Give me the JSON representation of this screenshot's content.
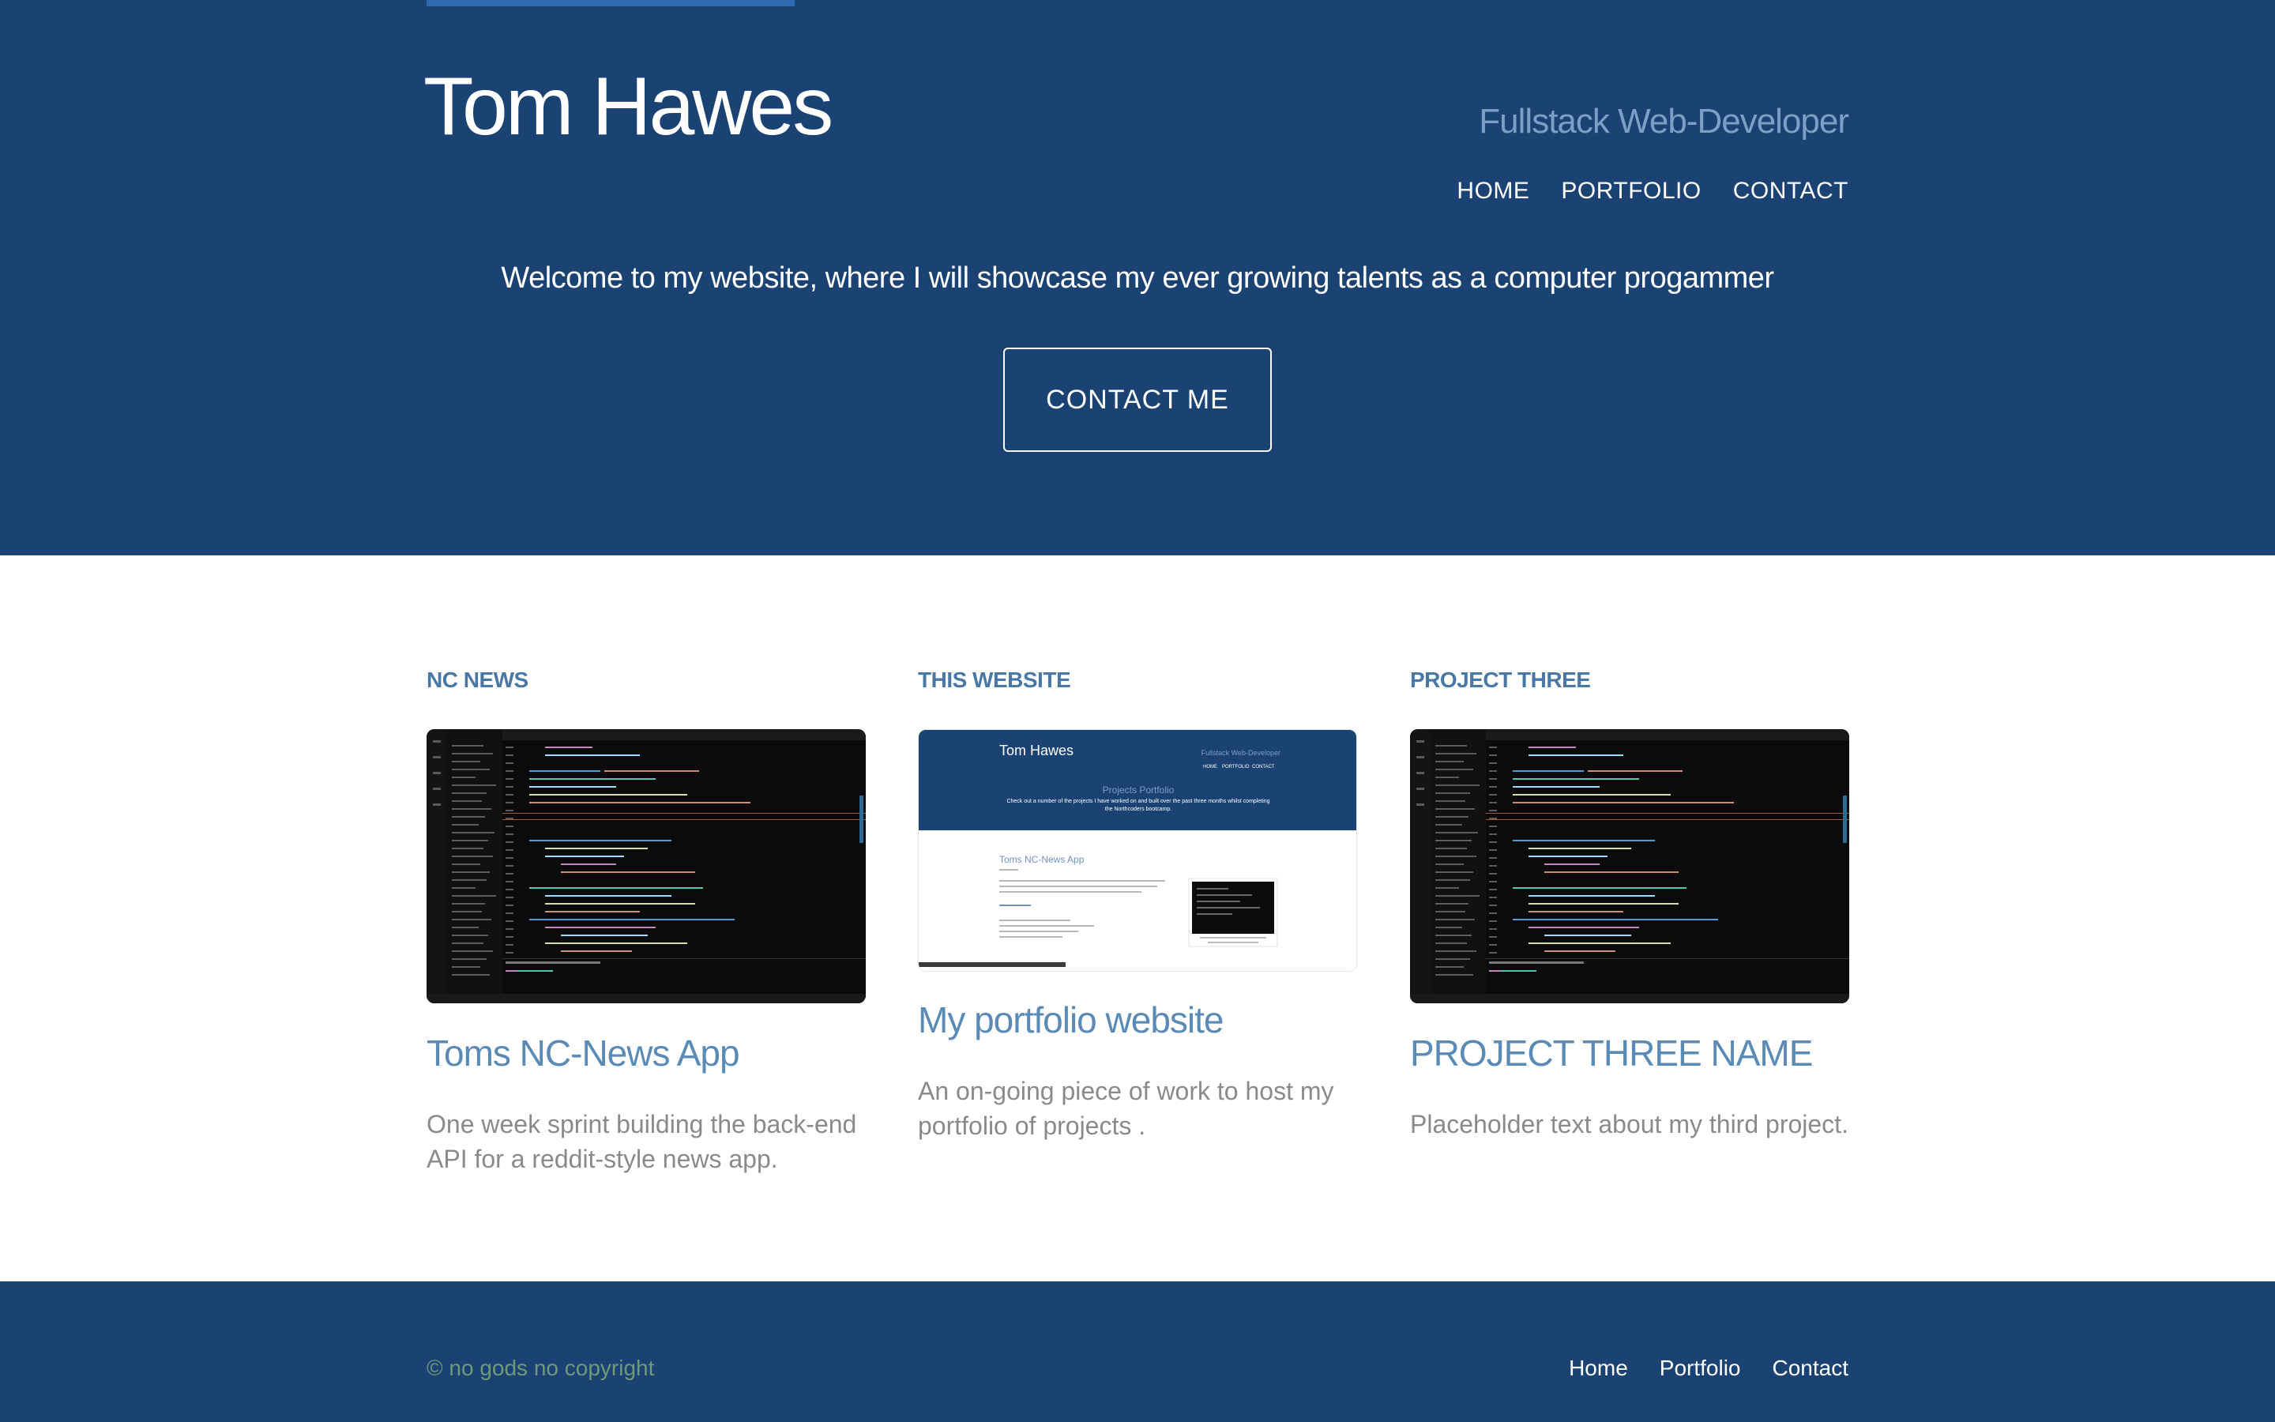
{
  "header": {
    "title": "Tom Hawes",
    "tagline": "Fullstack Web-Developer",
    "nav": [
      {
        "label": "HOME"
      },
      {
        "label": "PORTFOLIO"
      },
      {
        "label": "CONTACT"
      }
    ],
    "welcome": "Welcome to my website, where I will showcase my ever growing talents as a computer progammer",
    "cta_label": "CONTACT ME"
  },
  "projects": [
    {
      "heading": "NC NEWS",
      "name": "Toms NC-News App",
      "description": "One week sprint building the back-end API for a reddit-style news app."
    },
    {
      "heading": "THIS WEBSITE",
      "name": "My portfolio website",
      "description": "An on-going piece of work to host my portfolio of projects .",
      "thumbnail": {
        "title": "Tom Hawes",
        "tagline": "Fullstack Web-Developer",
        "nav": [
          "HOME",
          "PORTFOLIO",
          "CONTACT"
        ],
        "heading": "Projects Portfolio",
        "blurb": "Check out a number of the projects I have worked on and built over the past three months whilst completing the Northcoders bootcamp.",
        "item_title": "Toms NC-News App"
      }
    },
    {
      "heading": "PROJECT THREE",
      "name": "PROJECT THREE NAME",
      "description": "Placeholder text about my third project."
    }
  ],
  "footer": {
    "copyright": "© no gods no copyright",
    "nav": [
      {
        "label": "Home"
      },
      {
        "label": "Portfolio"
      },
      {
        "label": "Contact"
      }
    ]
  },
  "colors": {
    "brand": "#1a4273",
    "accent": "#2e6bb0",
    "project_heading": "#4a78a6",
    "project_name": "#5a8ab6",
    "copyright": "#6f9a78"
  }
}
